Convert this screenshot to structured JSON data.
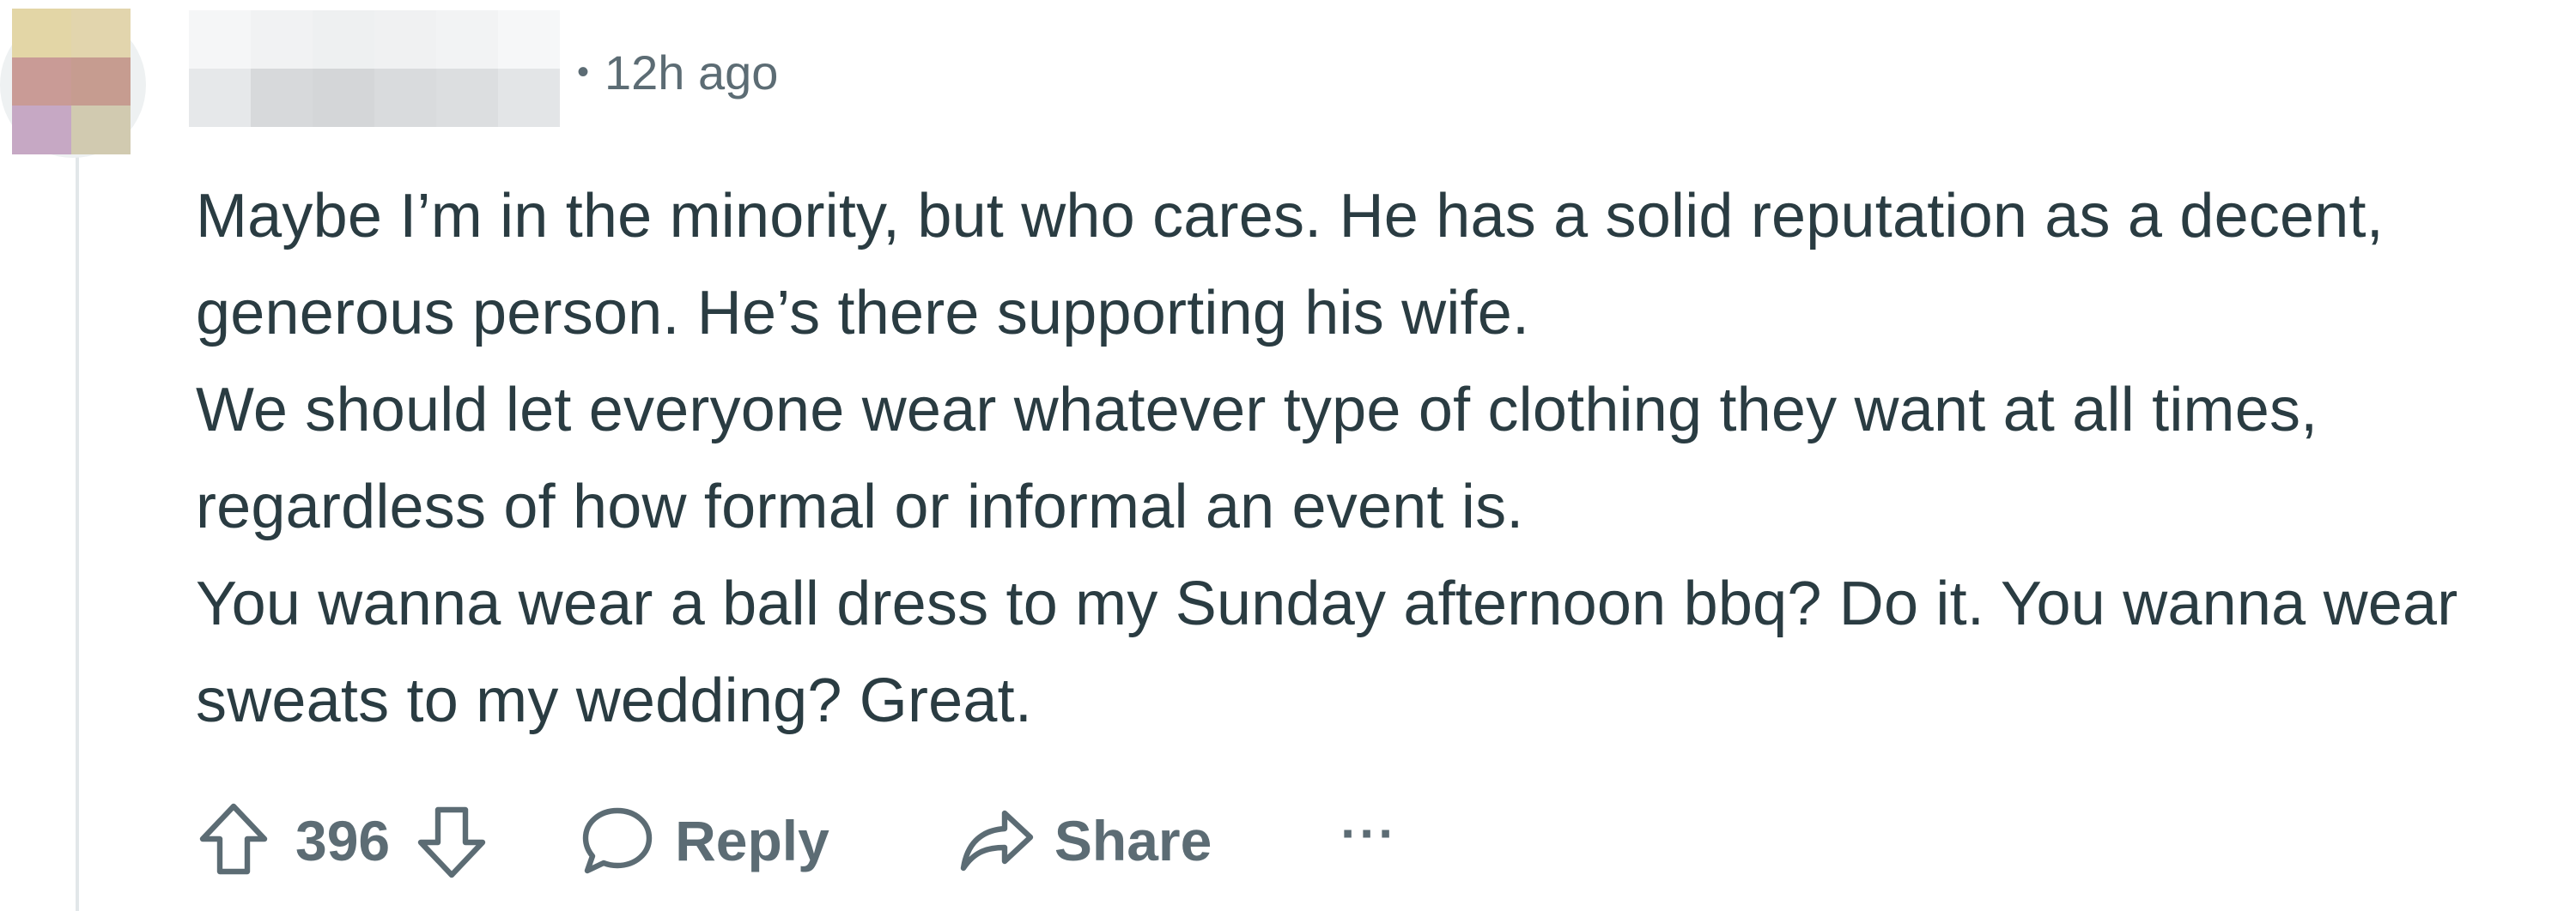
{
  "comment": {
    "meta": {
      "separator": "•",
      "timestamp": "12h ago"
    },
    "paragraphs": [
      "Maybe I’m in the minority, but who cares. He has a solid reputation as a decent, generous person. He’s there supporting his wife.",
      "We should let everyone wear whatever type of clothing they want at all times, regardless of how formal or informal an event is.",
      "You wanna wear a ball dress to my Sunday afternoon bbq? Do it. You wanna wear sweats to my wedding? Great."
    ],
    "actions": {
      "vote_count": "396",
      "reply_label": "Reply",
      "share_label": "Share",
      "more_label": "···"
    }
  },
  "colors": {
    "text": "#2a3c42",
    "meta": "#5c6c74",
    "thread_line": "#e2e7e9"
  },
  "icons": {
    "upvote": "arrow-up-icon",
    "downvote": "arrow-down-icon",
    "reply": "speech-bubble-icon",
    "share": "share-arrow-icon",
    "more": "ellipsis-icon"
  }
}
